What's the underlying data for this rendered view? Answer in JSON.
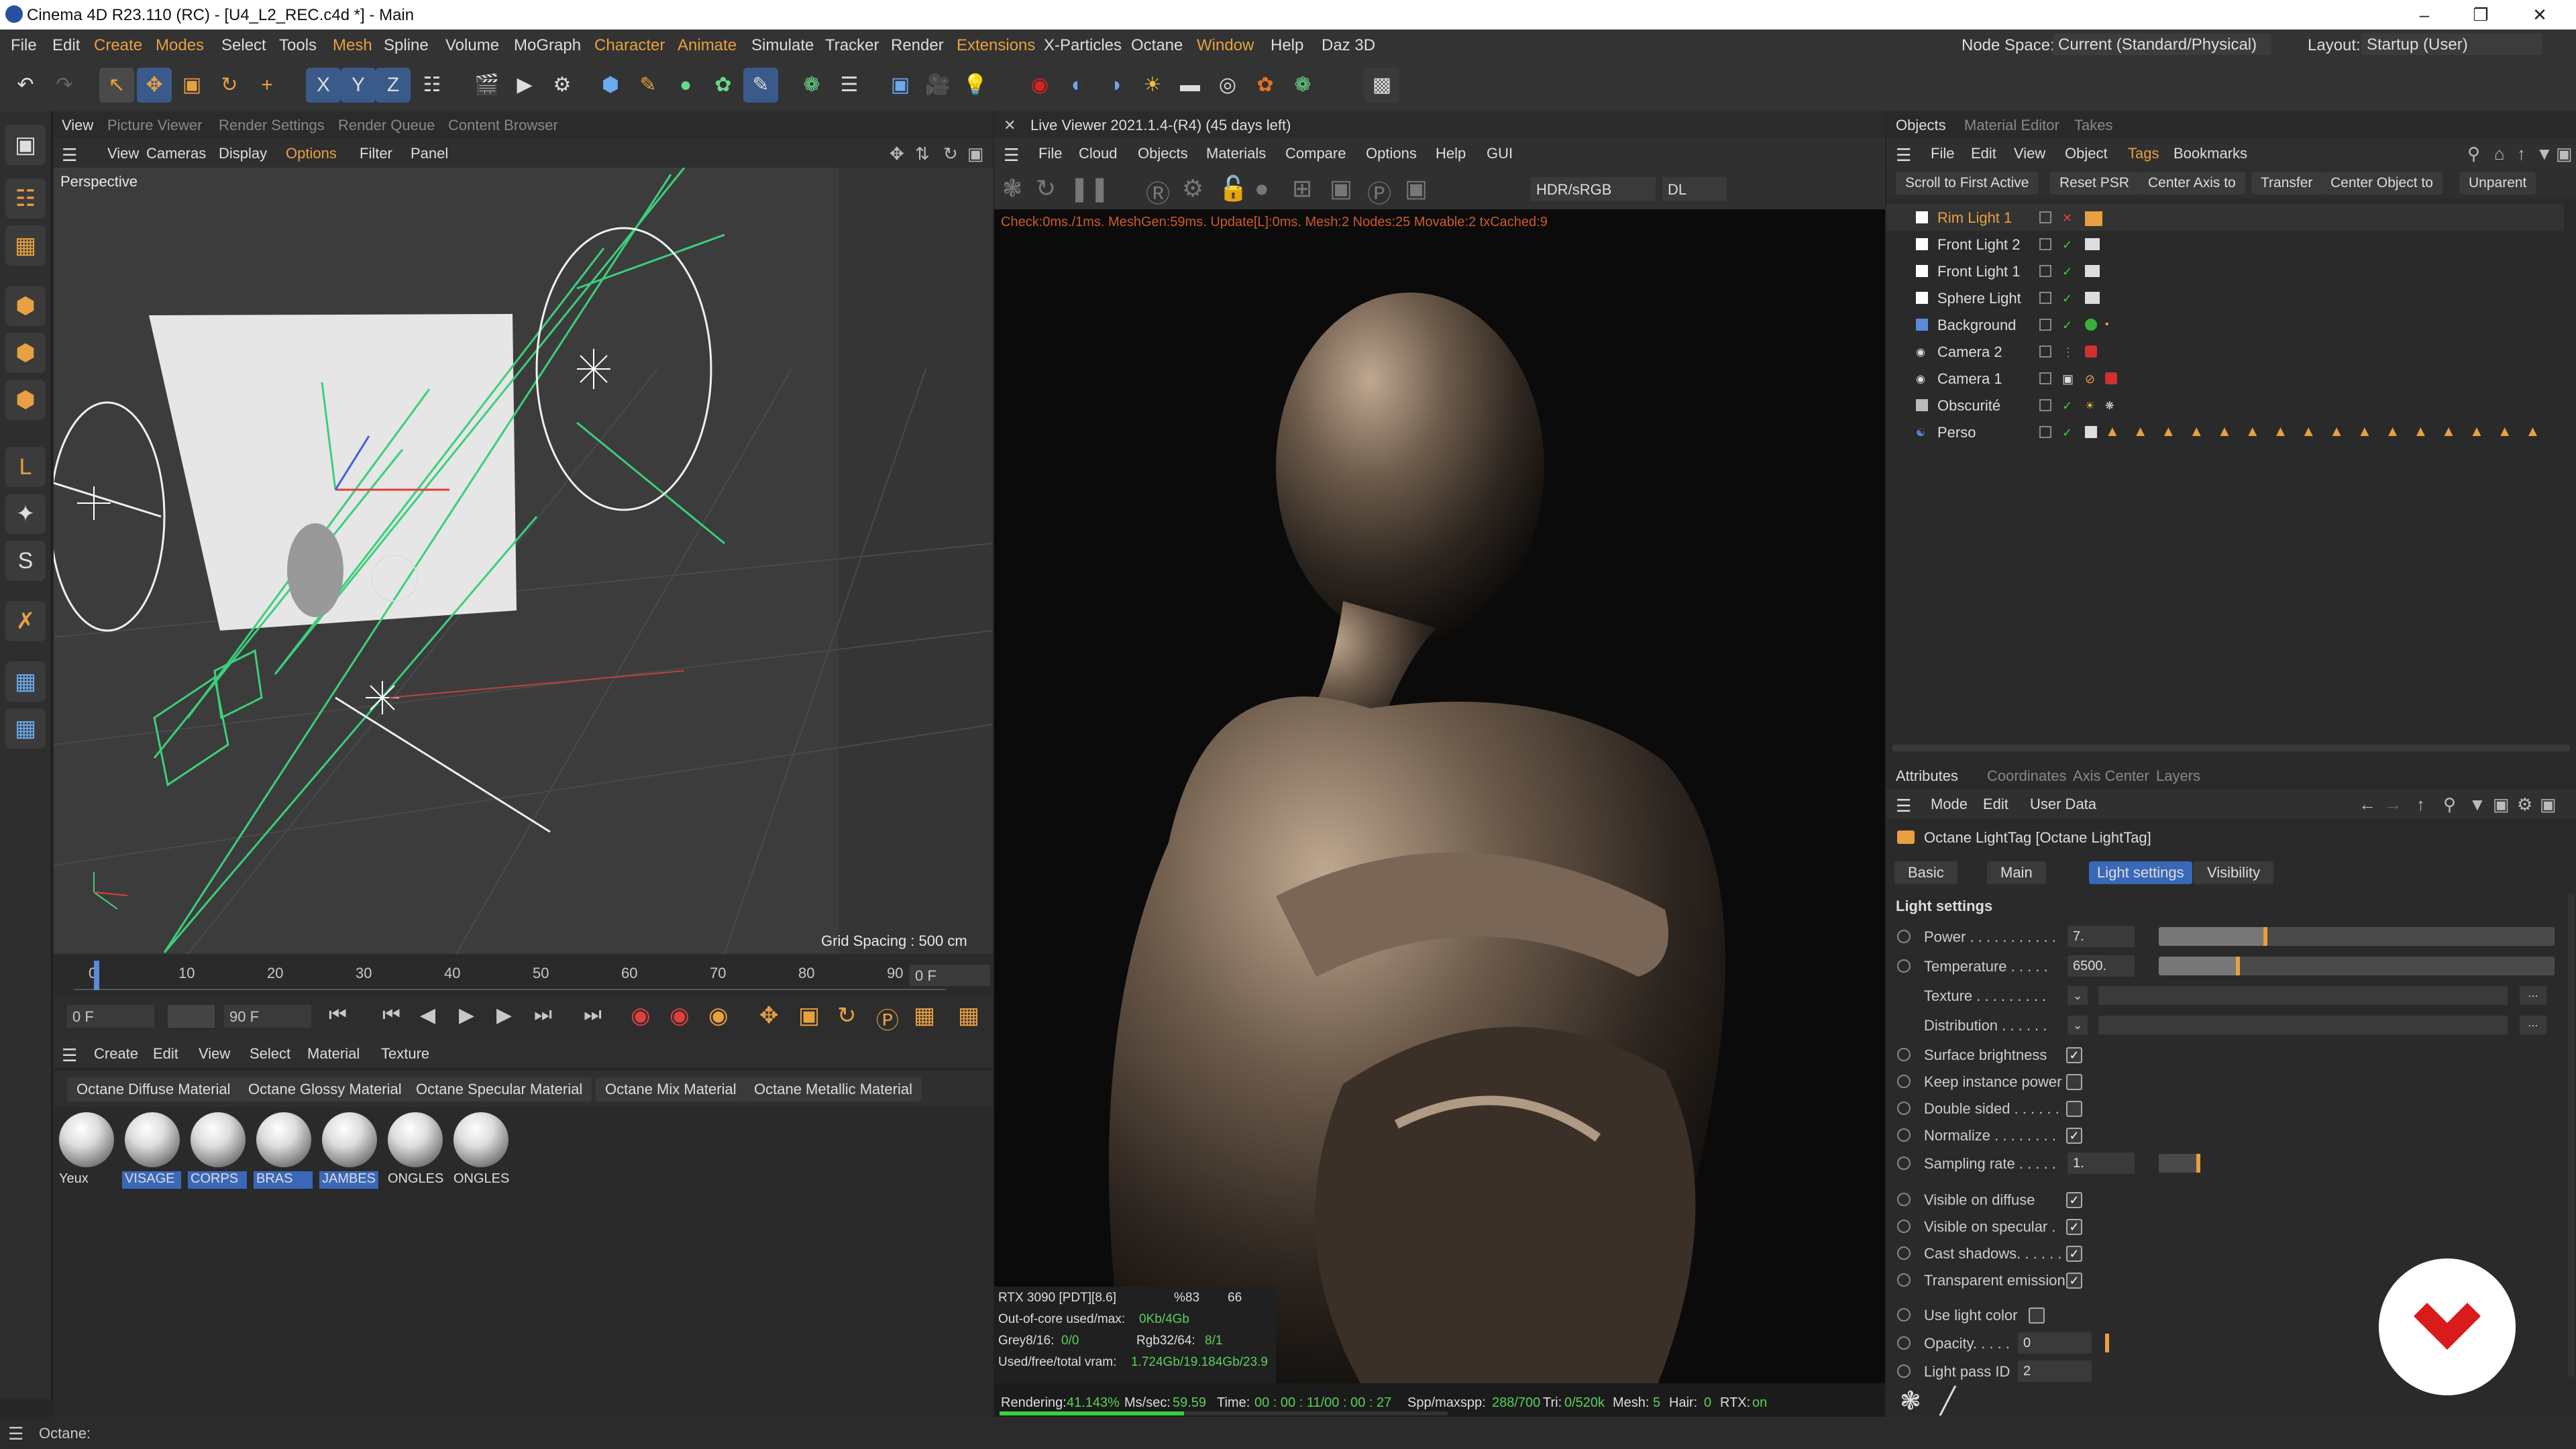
{
  "window": {
    "title": "Cinema 4D R23.110 (RC) - [U4_L2_REC.c4d *] - Main"
  },
  "menu": [
    "File",
    "Edit",
    "Create",
    "Modes",
    "Select",
    "Tools",
    "Mesh",
    "Spline",
    "Volume",
    "MoGraph",
    "Character",
    "Animate",
    "Simulate",
    "Tracker",
    "Render",
    "Extensions",
    "X-Particles",
    "Octane",
    "Window",
    "Help",
    "Daz 3D"
  ],
  "node_space": {
    "label": "Node Space:",
    "value": "Current (Standard/Physical)"
  },
  "layout": {
    "label": "Layout:",
    "value": "Startup (User)"
  },
  "viewport": {
    "tabs": [
      "View",
      "Picture Viewer",
      "Render Settings",
      "Render Queue",
      "Content Browser"
    ],
    "menu": [
      "View",
      "Cameras",
      "Display",
      "Options",
      "Filter",
      "Panel"
    ],
    "label": "Perspective",
    "grid_spacing": "Grid Spacing : 500 cm"
  },
  "timeline": {
    "ticks": [
      "0",
      "10",
      "20",
      "30",
      "40",
      "50",
      "60",
      "70",
      "80",
      "90"
    ],
    "current": "0 F",
    "start": "0 F",
    "end": "90 F",
    "end2": "90 F"
  },
  "materials": {
    "menu": [
      "Create",
      "Edit",
      "View",
      "Select",
      "Material",
      "Texture"
    ],
    "tabs": [
      "Octane Diffuse Material",
      "Octane Glossy Material",
      "Octane Specular Material",
      "Octane Mix Material",
      "Octane Metallic Material"
    ],
    "items": [
      {
        "name": "Yeux",
        "selected": false
      },
      {
        "name": "VISAGE",
        "selected": true
      },
      {
        "name": "CORPS",
        "selected": true
      },
      {
        "name": "BRAS",
        "selected": true
      },
      {
        "name": "JAMBES",
        "selected": true
      },
      {
        "name": "ONGLES",
        "selected": false
      },
      {
        "name": "ONGLES",
        "selected": false
      }
    ]
  },
  "live_viewer": {
    "title": "Live Viewer 2021.1.4-(R4) (45 days left)",
    "menu": [
      "File",
      "Cloud",
      "Objects",
      "Materials",
      "Compare",
      "Options",
      "Help",
      "GUI"
    ],
    "color_space": "HDR/sRGB",
    "pass": "DL",
    "info": "Check:0ms./1ms. MeshGen:59ms. Update[L]:0ms. Mesh:2 Nodes:25 Movable:2 txCached:9",
    "gpu": "RTX 3090 [PDT][8.6]",
    "gpu_pct": "%83",
    "gpu_temp": "66",
    "out_of_core_label": "Out-of-core used/max:",
    "out_of_core_value": "0Kb/4Gb",
    "grey_label": "Grey8/16:",
    "grey_value": "0/0",
    "rgb_label": "Rgb32/64:",
    "rgb_value": "8/1",
    "vram_label": "Used/free/total vram:",
    "vram_value": "1.724Gb/19.184Gb/23.9",
    "rendering_label": "Rendering:",
    "rendering_value": "41.143%",
    "progress": 0.41143,
    "mssec_label": "Ms/sec:",
    "mssec_value": "59.59",
    "time_label": "Time:",
    "time_value": "00 : 00 : 11/00 : 00 : 27",
    "spp_label": "Spp/maxspp:",
    "spp_value": "288/700",
    "tri_label": "Tri:",
    "tri_value": "0/520k",
    "mesh_label": "Mesh:",
    "mesh_value": "5",
    "hair_label": "Hair:",
    "hair_value": "0",
    "rtx_label": "RTX:",
    "rtx_value": "on"
  },
  "objects": {
    "tabs": [
      "Objects",
      "Material Editor",
      "Takes"
    ],
    "menu": [
      "File",
      "Edit",
      "View",
      "Object",
      "Tags",
      "Bookmarks"
    ],
    "buttons": [
      "Scroll to First Active",
      "Reset PSR",
      "Center Axis to",
      "Transfer",
      "Center Object to",
      "Unparent"
    ],
    "items": [
      {
        "name": "Rim Light 1",
        "active": true
      },
      {
        "name": "Front Light 2",
        "active": false
      },
      {
        "name": "Front Light 1",
        "active": false
      },
      {
        "name": "Sphere Light",
        "active": false
      },
      {
        "name": "Background",
        "active": false
      },
      {
        "name": "Camera 2",
        "active": false
      },
      {
        "name": "Camera 1",
        "active": false
      },
      {
        "name": "Obscurité",
        "active": false
      },
      {
        "name": "Perso",
        "active": false
      }
    ]
  },
  "attributes": {
    "tabs": [
      "Attributes",
      "Coordinates",
      "Axis Center",
      "Layers"
    ],
    "menu": [
      "Mode",
      "Edit",
      "User Data"
    ],
    "object_title": "Octane LightTag [Octane LightTag]",
    "subtabs": [
      "Basic",
      "Main",
      "Light settings",
      "Visibility"
    ],
    "section": "Light settings",
    "power": {
      "label": "Power . . . . . . . . . . .",
      "value": "7.",
      "level": 0.27
    },
    "temperature": {
      "label": "Temperature . . . . .",
      "value": "6500.",
      "level": 0.2
    },
    "texture": {
      "label": "Texture . . . . . . . . ."
    },
    "distribution": {
      "label": "Distribution . . . . . ."
    },
    "checks": [
      {
        "label": "Surface brightness",
        "checked": true
      },
      {
        "label": "Keep instance power",
        "checked": false
      },
      {
        "label": "Double sided . . . . . .",
        "checked": false
      },
      {
        "label": "Normalize . . . . . . . .",
        "checked": true
      }
    ],
    "sampling": {
      "label": "Sampling rate . . . . .",
      "value": "1.",
      "level": 0.04
    },
    "vis_checks": [
      {
        "label": "Visible on diffuse",
        "checked": true
      },
      {
        "label": "Visible on specular .",
        "checked": true
      },
      {
        "label": "Cast shadows. . . . . .",
        "checked": true
      },
      {
        "label": "Transparent emission",
        "checked": true
      }
    ],
    "use_light_color": {
      "label": "Use light color",
      "checked": false
    },
    "opacity": {
      "label": "Opacity. . . . .",
      "value": "0"
    },
    "light_pass": {
      "label": "Light pass ID",
      "value": "2"
    }
  },
  "status": {
    "text": "Octane:"
  }
}
